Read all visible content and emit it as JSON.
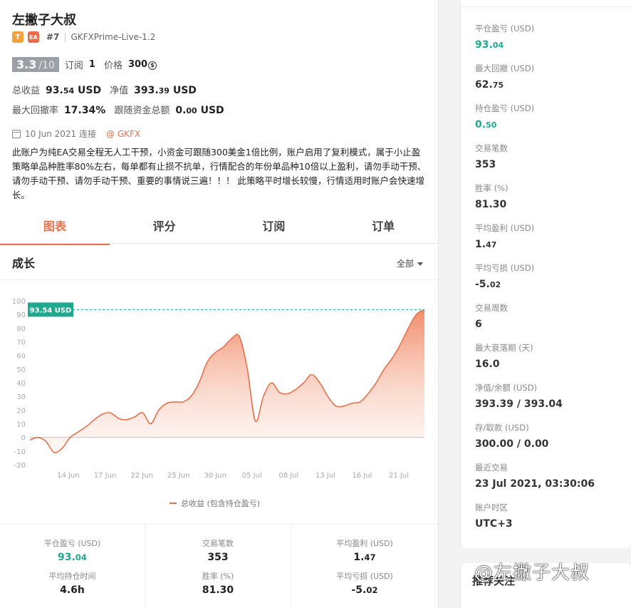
{
  "header": {
    "title": "左撇子大叔",
    "tag_t": "T",
    "tag_ea": "EA",
    "rank": "#7",
    "server": "GKFXPrime-Live-1.2"
  },
  "rating": {
    "score": "3.3",
    "denominator": "/10",
    "subscribe_label": "订阅",
    "subscribe_count": "1",
    "price_label": "价格",
    "price_value": "300",
    "coin_symbol": "$"
  },
  "summary": {
    "total_profit_label": "总收益",
    "total_profit_int": "93.",
    "total_profit_dec": "54",
    "total_profit_unit": "USD",
    "equity_label": "净值",
    "equity_int": "393.",
    "equity_dec": "39",
    "equity_unit": "USD",
    "max_dd_label": "最大回撤率",
    "max_dd_value": "17.34%",
    "follow_label": "跟随资金总额",
    "follow_int": "0.",
    "follow_dec": "00",
    "follow_unit": "USD"
  },
  "meta": {
    "date": "10 Jun 2021 连接",
    "broker": "@ GKFX"
  },
  "description": "此账户为纯EA交易全程无人工干预，小资金可跟随300美金1倍比例，账户启用了复利模式，属于小止盈策略单品种胜率80%左右，每单都有止损不抗单，行情配合的年份单品种10倍以上盈利，请勿手动干预、请勿手动干预、请勿手动干预、重要的事情说三遍！！！ 此策略平时增长较慢，行情适用时账户会快速增长。",
  "tabs": [
    "图表",
    "评分",
    "订阅",
    "订单"
  ],
  "growth": {
    "title": "成长",
    "range": "全部",
    "legend": "总收益 (包含持仓盈亏)",
    "badge": "93.54 USD"
  },
  "chart_data": {
    "type": "area",
    "x_ticks": [
      "14 Jun",
      "17 Jun",
      "22 Jun",
      "25 Jun",
      "30 Jun",
      "05 Jul",
      "08 Jul",
      "13 Jul",
      "16 Jul",
      "21 Jul"
    ],
    "y_ticks": [
      100,
      90,
      80,
      70,
      60,
      50,
      40,
      30,
      20,
      10,
      0,
      -10,
      -20
    ],
    "ylim": [
      -20,
      100
    ],
    "series": [
      {
        "name": "总收益 (包含持仓盈亏)",
        "color": "#e8704b",
        "values": [
          -2,
          0,
          -3,
          -11,
          -8,
          0,
          4,
          8,
          13,
          17,
          18,
          14,
          13,
          15,
          18,
          10,
          20,
          25,
          26,
          26,
          30,
          40,
          55,
          62,
          66,
          72,
          74,
          50,
          12,
          30,
          40,
          33,
          32,
          35,
          40,
          46,
          40,
          30,
          23,
          23,
          25,
          26,
          32,
          40,
          50,
          58,
          68,
          80,
          90,
          93.54
        ]
      }
    ],
    "last_value": 93.54
  },
  "stats": {
    "col1": [
      {
        "label": "平仓盈亏 (USD)",
        "int": "93.",
        "dec": "04",
        "green": true
      },
      {
        "label": "平均持仓时间",
        "int": "4.6h",
        "dec": "",
        "green": false
      }
    ],
    "col2": [
      {
        "label": "交易笔数",
        "int": "353",
        "dec": "",
        "green": false
      },
      {
        "label": "胜率 (%)",
        "int": "81.30",
        "dec": "",
        "green": false
      }
    ],
    "col3": [
      {
        "label": "平均盈利 (USD)",
        "int": "1.",
        "dec": "47",
        "green": false
      },
      {
        "label": "平均亏损 (USD)",
        "int": "-5.",
        "dec": "02",
        "green": false
      }
    ]
  },
  "right": [
    {
      "label": "平仓盈亏 (USD)",
      "int": "93.",
      "dec": "04",
      "green": true
    },
    {
      "label": "最大回撤 (USD)",
      "int": "62.",
      "dec": "75",
      "green": false
    },
    {
      "label": "持仓盈亏 (USD)",
      "int": "0.",
      "dec": "50",
      "green": true
    },
    {
      "label": "交易笔数",
      "int": "353",
      "dec": "",
      "green": false
    },
    {
      "label": "胜率 (%)",
      "int": "81.30",
      "dec": "",
      "green": false
    },
    {
      "label": "平均盈利 (USD)",
      "int": "1.",
      "dec": "47",
      "green": false
    },
    {
      "label": "平均亏损 (USD)",
      "int": "-5.",
      "dec": "02",
      "green": false
    },
    {
      "label": "交易周数",
      "int": "6",
      "dec": "",
      "green": false
    },
    {
      "label": "最大衰落期 (天)",
      "int": "16.0",
      "dec": "",
      "green": false
    },
    {
      "label": "净值/余额 (USD)",
      "int": "393.39 / 393.04",
      "dec": "",
      "green": false
    },
    {
      "label": "存/取款 (USD)",
      "int": "300.00 / 0.00",
      "dec": "",
      "green": false
    },
    {
      "label": "最近交易",
      "int": "23 Jul 2021, 03:30:06",
      "dec": "",
      "green": false
    },
    {
      "label": "账户时区",
      "int": "UTC+3",
      "dec": "",
      "green": false
    }
  ],
  "recommend": "推荐关注",
  "watermark": "@左撇子大叔"
}
